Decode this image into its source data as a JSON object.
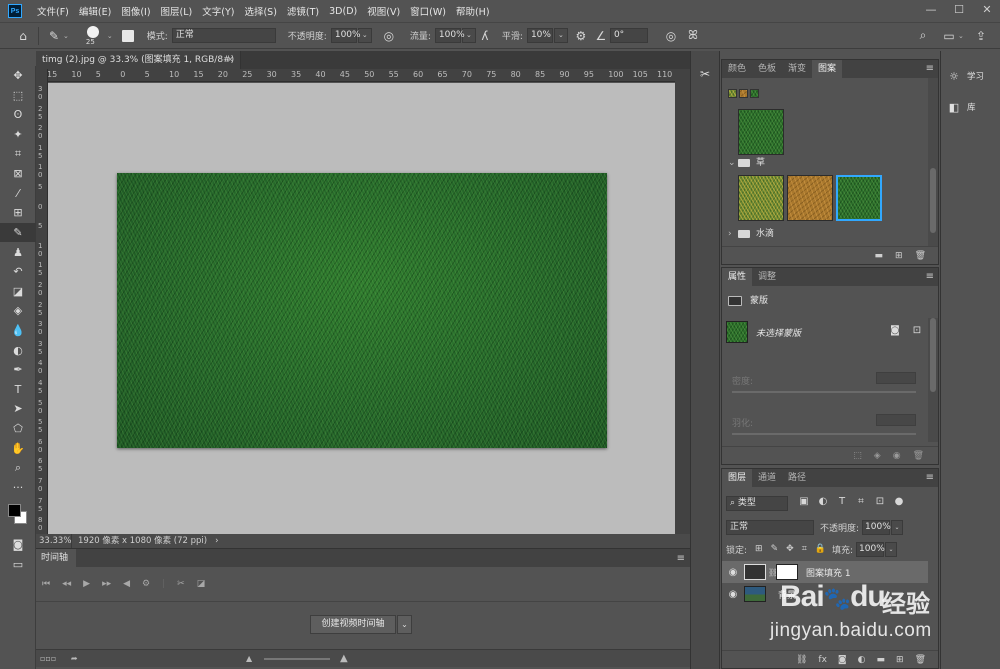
{
  "menu": {
    "logo": "Ps",
    "items": [
      "文件(F)",
      "编辑(E)",
      "图像(I)",
      "图层(L)",
      "文字(Y)",
      "选择(S)",
      "滤镜(T)",
      "3D(D)",
      "视图(V)",
      "窗口(W)",
      "帮助(H)"
    ],
    "window_min": "—",
    "window_max": "☐",
    "window_close": "✕"
  },
  "options": {
    "brush_size": "25",
    "mode_label": "模式:",
    "mode_value": "正常",
    "opacity_label": "不透明度:",
    "opacity_value": "100%",
    "flow_label": "流量:",
    "flow_value": "100%",
    "smooth_label": "平滑:",
    "smooth_value": "10%",
    "angle_value": "0°"
  },
  "document": {
    "tab_title": "timg (2).jpg @ 33.3% (图案填充 1, RGB/8#) *",
    "close": "×",
    "ruler_top": [
      "15",
      "10",
      "5",
      "0",
      "5",
      "10",
      "15",
      "20",
      "25",
      "30",
      "35",
      "40",
      "45",
      "50",
      "55",
      "60",
      "65",
      "70",
      "75",
      "80",
      "85",
      "90",
      "95",
      "100",
      "105",
      "110"
    ],
    "ruler_left": [
      "3\n0",
      "2\n5",
      "2\n0",
      "1\n5",
      "1\n0",
      "5",
      "0",
      "5",
      "1\n0",
      "1\n5",
      "2\n0",
      "2\n5",
      "3\n0",
      "3\n5",
      "4\n0",
      "4\n5",
      "5\n0",
      "5\n5",
      "6\n0",
      "6\n5",
      "7\n0",
      "7\n5",
      "8\n0"
    ]
  },
  "status": {
    "zoom": "33.33%",
    "info": "1920 像素 x 1080 像素 (72 ppi)",
    "arrow": "›"
  },
  "timeline": {
    "tab": "时间轴",
    "create_button": "创建视频时间轴",
    "dropdown": "⌄"
  },
  "patterns_panel": {
    "tabs": [
      "颜色",
      "色板",
      "渐变",
      "图案"
    ],
    "active_tab": "图案",
    "folder_grass": "草",
    "folder_water": "水滴"
  },
  "properties_panel": {
    "tabs": [
      "属性",
      "调整"
    ],
    "section": "蒙版",
    "no_mask": "未选择蒙版",
    "density_label": "密度:",
    "feather_label": "羽化:"
  },
  "layers_panel": {
    "tabs": [
      "图层",
      "通道",
      "路径"
    ],
    "filter_kind": "类型",
    "blend_mode": "正常",
    "opacity_label": "不透明度:",
    "opacity_value": "100%",
    "lock_label": "锁定:",
    "fill_label": "填充:",
    "fill_value": "100%",
    "layers": [
      {
        "name": "图案填充 1"
      },
      {
        "name": "背景"
      }
    ]
  },
  "right_column": {
    "learn": "学习",
    "library": "库"
  },
  "watermark": {
    "brand": "Bai",
    "brand2": "du",
    "cn": "经验",
    "url": "jingyan.baidu.com"
  },
  "colors": {
    "accent_selected": "#31a8ff",
    "ui_bg": "#535353",
    "grass": "#2c6f2c"
  }
}
